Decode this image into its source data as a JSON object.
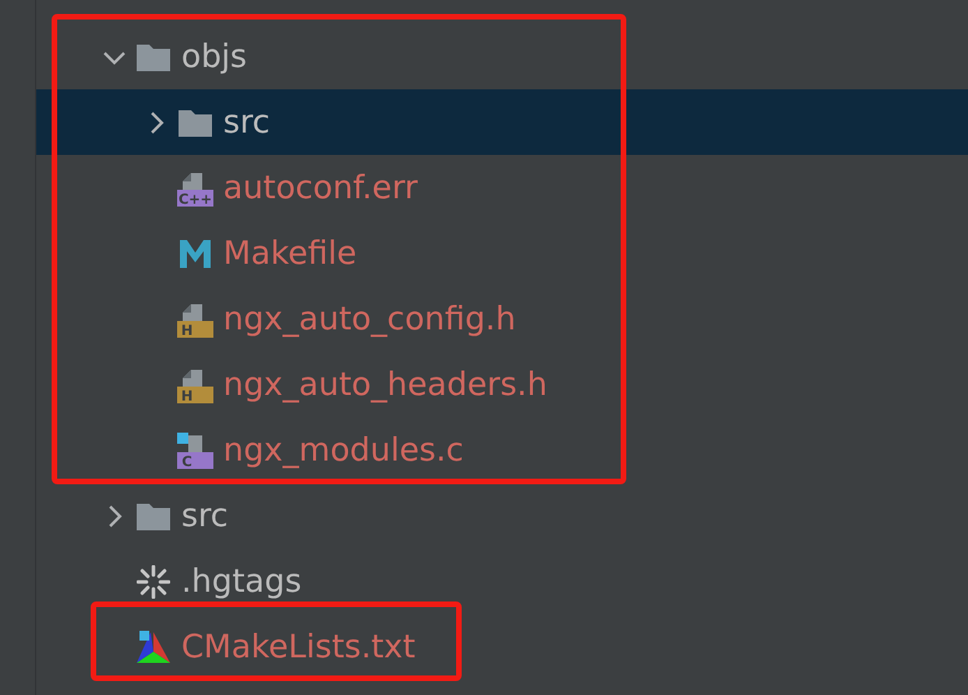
{
  "tree": [
    {
      "name": "objs",
      "kind": "folder",
      "expanded": true,
      "selected": false,
      "untracked": false,
      "highlighted": true,
      "children": [
        {
          "name": "src",
          "kind": "folder",
          "expanded": false,
          "selected": true,
          "untracked": false,
          "highlighted": false
        },
        {
          "name": "autoconf.err",
          "kind": "cpp",
          "icon_label": "C++",
          "selected": false,
          "untracked": true,
          "highlighted": false
        },
        {
          "name": "Makefile",
          "kind": "makefile",
          "selected": false,
          "untracked": true,
          "highlighted": false
        },
        {
          "name": "ngx_auto_config.h",
          "kind": "header",
          "icon_label": "H",
          "selected": false,
          "untracked": true,
          "highlighted": false
        },
        {
          "name": "ngx_auto_headers.h",
          "kind": "header",
          "icon_label": "H",
          "selected": false,
          "untracked": true,
          "highlighted": false
        },
        {
          "name": "ngx_modules.c",
          "kind": "c",
          "icon_label": "C",
          "selected": false,
          "untracked": true,
          "highlighted": false
        }
      ]
    },
    {
      "name": "src",
      "kind": "folder",
      "expanded": false,
      "selected": false,
      "untracked": false,
      "highlighted": false
    },
    {
      "name": ".hgtags",
      "kind": "hg",
      "selected": false,
      "untracked": false,
      "highlighted": false
    },
    {
      "name": "CMakeLists.txt",
      "kind": "cmake",
      "selected": false,
      "untracked": true,
      "highlighted": true
    }
  ]
}
